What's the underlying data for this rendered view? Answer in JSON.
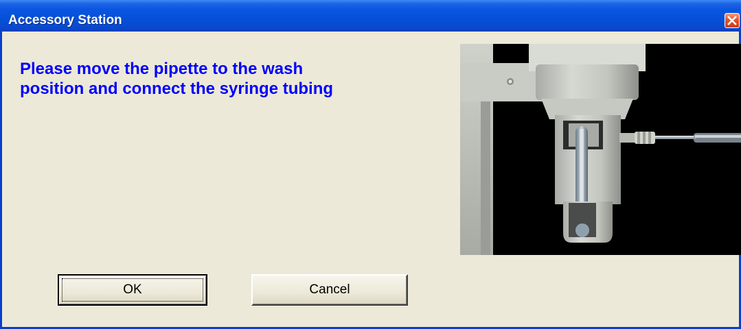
{
  "window": {
    "title": "Accessory Station"
  },
  "message": {
    "line1": "Please move the pipette to the wash",
    "line2": "position and connect the syringe tubing"
  },
  "buttons": {
    "ok_label": "OK",
    "cancel_label": "Cancel"
  },
  "icons": {
    "close": "close-icon"
  },
  "colors": {
    "titlebar": "#0650d8",
    "message_text": "#0000ff",
    "dialog_bg": "#ece9d8",
    "close_button": "#e2552f"
  }
}
